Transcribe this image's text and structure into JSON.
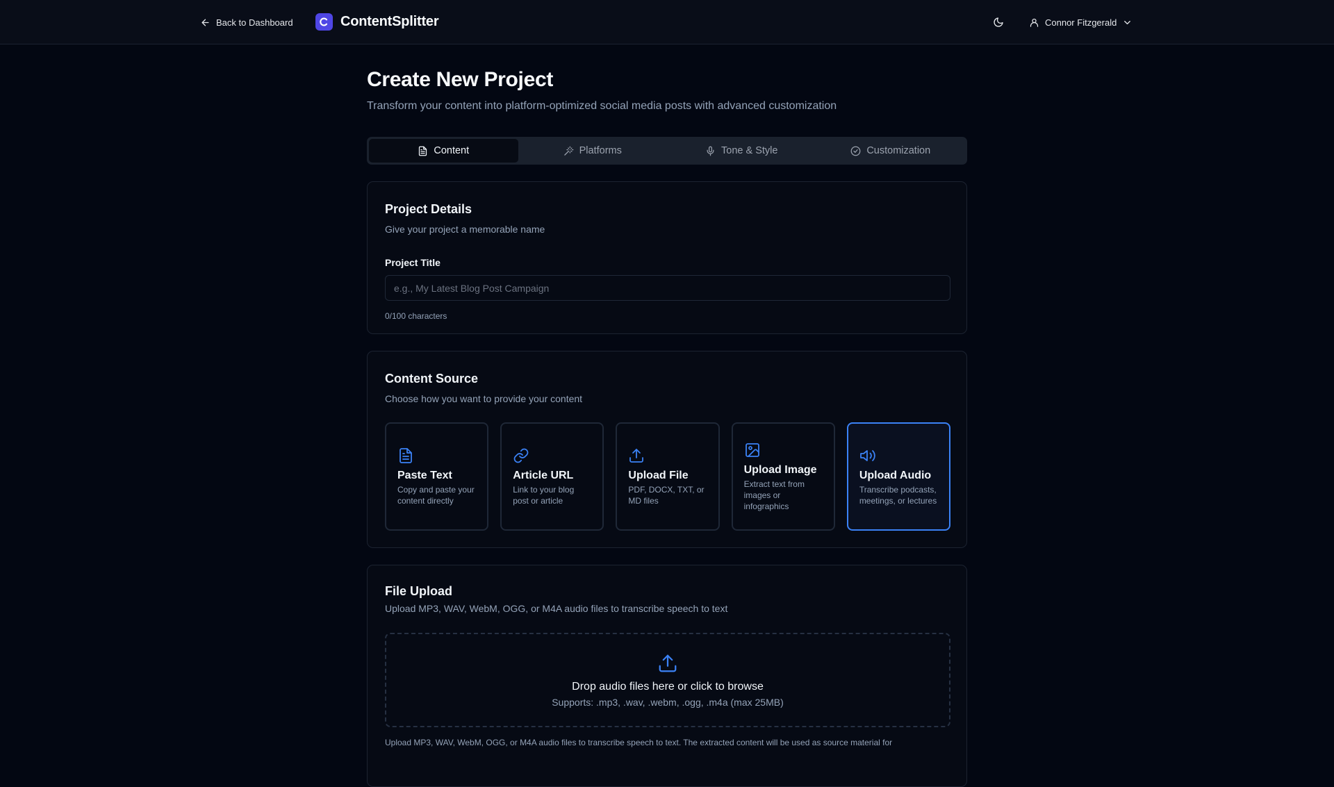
{
  "header": {
    "back_label": "Back to Dashboard",
    "brand_name": "ContentSplitter",
    "user_name": "Connor Fitzgerald"
  },
  "page": {
    "title": "Create New Project",
    "subtitle": "Transform your content into platform-optimized social media posts with advanced customization"
  },
  "tabs": [
    {
      "label": "Content",
      "icon": "document-icon",
      "active": true
    },
    {
      "label": "Platforms",
      "icon": "wand-icon",
      "active": false
    },
    {
      "label": "Tone & Style",
      "icon": "microphone-icon",
      "active": false
    },
    {
      "label": "Customization",
      "icon": "check-circle-icon",
      "active": false
    }
  ],
  "project_details": {
    "title": "Project Details",
    "description": "Give your project a memorable name",
    "field_label": "Project Title",
    "placeholder": "e.g., My Latest Blog Post Campaign",
    "value": "",
    "char_count": "0/100 characters"
  },
  "content_source": {
    "title": "Content Source",
    "description": "Choose how you want to provide your content",
    "selected": "Upload Audio",
    "options": [
      {
        "title": "Paste Text",
        "desc": "Copy and paste your content directly",
        "icon": "document-icon"
      },
      {
        "title": "Article URL",
        "desc": "Link to your blog post or article",
        "icon": "link-icon"
      },
      {
        "title": "Upload File",
        "desc": "PDF, DOCX, TXT, or MD files",
        "icon": "upload-icon"
      },
      {
        "title": "Upload Image",
        "desc": "Extract text from images or infographics",
        "icon": "image-icon"
      },
      {
        "title": "Upload Audio",
        "desc": "Transcribe podcasts, meetings, or lectures",
        "icon": "speaker-icon"
      }
    ]
  },
  "file_upload": {
    "title": "File Upload",
    "description": "Upload MP3, WAV, WebM, OGG, or M4A audio files to transcribe speech to text",
    "drop_title": "Drop audio files here or click to browse",
    "drop_support": "Supports: .mp3, .wav, .webm, .ogg, .m4a (max 25MB)",
    "note": "Upload MP3, WAV, WebM, OGG, or M4A audio files to transcribe speech to text. The extracted content will be used as source material for"
  },
  "colors": {
    "background": "#030712",
    "card": "#060a14",
    "accent": "#3b82f6",
    "brand": "#4f46e5",
    "muted_text": "#94a3b8"
  }
}
